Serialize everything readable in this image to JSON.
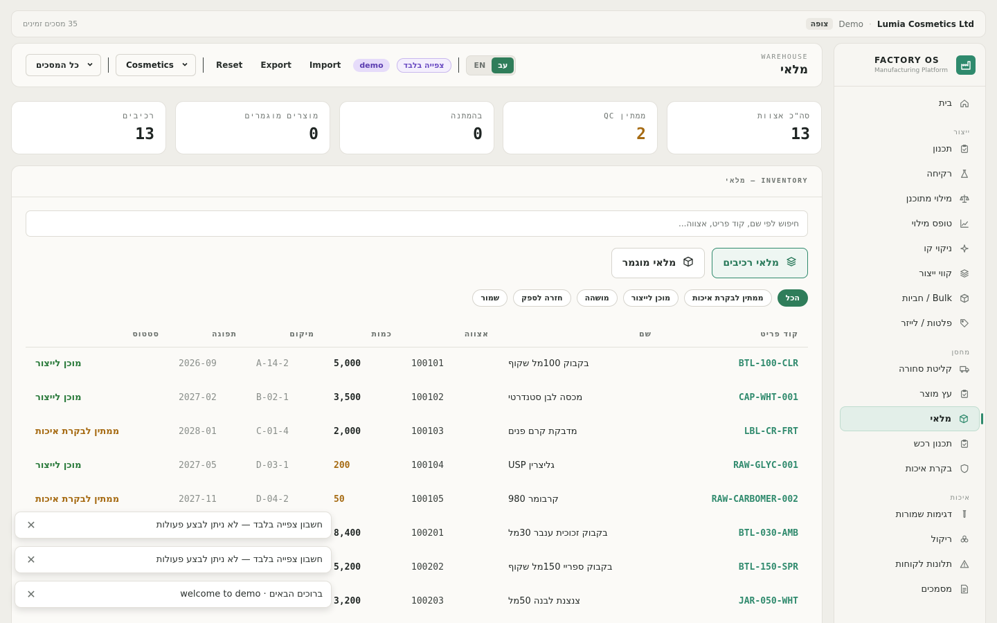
{
  "topbar": {
    "company": "Lumia Cosmetics Ltd",
    "mode": "Demo",
    "viewer_badge": "צופה",
    "screens_count": "35 מסכים זמינים"
  },
  "brand": {
    "title": "FACTORY OS",
    "subtitle": "Manufacturing Platform"
  },
  "sidebar": {
    "items": [
      {
        "label": "בית",
        "icon": "home-icon",
        "section": ""
      },
      {
        "label": "תכנון",
        "icon": "clipboard-icon",
        "section": "ייצור"
      },
      {
        "label": "רקיחה",
        "icon": "flask-icon",
        "section": ""
      },
      {
        "label": "מילוי מתוכנן",
        "icon": "scale-icon",
        "section": ""
      },
      {
        "label": "טופס מילוי",
        "icon": "chart-icon",
        "section": ""
      },
      {
        "label": "ניקוי קו",
        "icon": "sparkle-icon",
        "section": ""
      },
      {
        "label": "קווי ייצור",
        "icon": "layers-icon",
        "section": ""
      },
      {
        "label": "Bulk / חביות",
        "icon": "box-icon",
        "section": ""
      },
      {
        "label": "פלטות / לייזר",
        "icon": "tag-icon",
        "section": ""
      },
      {
        "label": "קליטת סחורה",
        "icon": "truck-icon",
        "section": "מחסן"
      },
      {
        "label": "עץ מוצר",
        "icon": "clipboard-icon",
        "section": ""
      },
      {
        "label": "מלאי",
        "icon": "box-icon",
        "section": "",
        "active": true
      },
      {
        "label": "תכנון רכש",
        "icon": "clipboard-icon",
        "section": ""
      },
      {
        "label": "בקרת איכות",
        "icon": "shield-icon",
        "section": ""
      },
      {
        "label": "דגימות שמורות",
        "icon": "tube-icon",
        "section": "איכות"
      },
      {
        "label": "ריקול",
        "icon": "biohazard-icon",
        "section": ""
      },
      {
        "label": "תלונות לקוחות",
        "icon": "warning-icon",
        "section": ""
      },
      {
        "label": "מסמכים",
        "icon": "document-icon",
        "section": ""
      }
    ]
  },
  "header": {
    "eyebrow": "WAREHOUSE",
    "title": "מלאי",
    "lang_he": "עב",
    "lang_en": "EN",
    "badge_viewonly": "צפייה בלבד",
    "badge_demo": "demo",
    "import_label": "Import",
    "export_label": "Export",
    "reset_label": "Reset",
    "category_value": "Cosmetics",
    "screens_value": "כל המסכים"
  },
  "stats": [
    {
      "label": "סה\"כ אצוות",
      "value": "13",
      "color": "#1f2523"
    },
    {
      "label": "ממתין QC",
      "value": "2",
      "color": "#a66b13"
    },
    {
      "label": "בהמתנה",
      "value": "0",
      "color": "#1f2523"
    },
    {
      "label": "מוצרים מוגמרים",
      "value": "0",
      "color": "#1f2523"
    },
    {
      "label": "רכיבים",
      "value": "13",
      "color": "#1f2523"
    }
  ],
  "inventory": {
    "panel_title": "INVENTORY — מלאי",
    "search_placeholder": "חיפוש לפי שם, קוד פריט, אצווה...",
    "view_components": "מלאי רכיבים",
    "view_finished": "מלאי מוגמר",
    "chips": [
      "הכל",
      "ממתין לבקרת איכות",
      "מוכן לייצור",
      "מושהה",
      "חזרה לספק",
      "שמור"
    ],
    "columns": [
      "קוד פריט",
      "שם",
      "אצווה",
      "כמות",
      "מיקום",
      "תפוגה",
      "סטטוס"
    ],
    "rows": [
      {
        "sku": "BTL-100-CLR",
        "name": "בקבוק 100מל שקוף",
        "batch": "100101",
        "qty": "5,000",
        "qty_low": false,
        "loc": "A-14-2",
        "exp": "2026-09",
        "status": "מוכן לייצור",
        "status_kind": "ready"
      },
      {
        "sku": "CAP-WHT-001",
        "name": "מכסה לבן סטנדרטי",
        "batch": "100102",
        "qty": "3,500",
        "qty_low": false,
        "loc": "B-02-1",
        "exp": "2027-02",
        "status": "מוכן לייצור",
        "status_kind": "ready"
      },
      {
        "sku": "LBL-CR-FRT",
        "name": "מדבקת קרם פנים",
        "batch": "100103",
        "qty": "2,000",
        "qty_low": false,
        "loc": "C-01-4",
        "exp": "2028-01",
        "status": "ממתין לבקרת איכות",
        "status_kind": "pending"
      },
      {
        "sku": "RAW-GLYC-001",
        "name": "גליצרין USP",
        "batch": "100104",
        "qty": "200",
        "qty_low": true,
        "loc": "D-03-1",
        "exp": "2027-05",
        "status": "מוכן לייצור",
        "status_kind": "ready"
      },
      {
        "sku": "RAW-CARBOMER-002",
        "name": "קרבומר 980",
        "batch": "100105",
        "qty": "50",
        "qty_low": true,
        "loc": "D-04-2",
        "exp": "2027-11",
        "status": "ממתין לבקרת איכות",
        "status_kind": "pending"
      },
      {
        "sku": "BTL-030-AMB",
        "name": "בקבוק זכוכית ענבר 30מל",
        "batch": "100201",
        "qty": "8,400",
        "qty_low": false,
        "loc": "",
        "exp": "",
        "status": "",
        "status_kind": "ready"
      },
      {
        "sku": "BTL-150-SPR",
        "name": "בקבוק ספריי 150מל שקוף",
        "batch": "100202",
        "qty": "5,200",
        "qty_low": false,
        "loc": "",
        "exp": "",
        "status": "",
        "status_kind": "ready"
      },
      {
        "sku": "JAR-050-WHT",
        "name": "צנצנת לבנה 50מל",
        "batch": "100203",
        "qty": "3,200",
        "qty_low": false,
        "loc": "",
        "exp": "",
        "status": "",
        "status_kind": "ready"
      }
    ]
  },
  "toasts": [
    {
      "text": "חשבון צפייה בלבד — לא ניתן לבצע פעולות"
    },
    {
      "text": "חשבון צפייה בלבד — לא ניתן לבצע פעולות"
    },
    {
      "text": "ברוכים הבאים · welcome to demo"
    }
  ],
  "colors": {
    "accent": "#2f8a6d",
    "warning": "#a66b13",
    "success": "#2a7a3b"
  }
}
